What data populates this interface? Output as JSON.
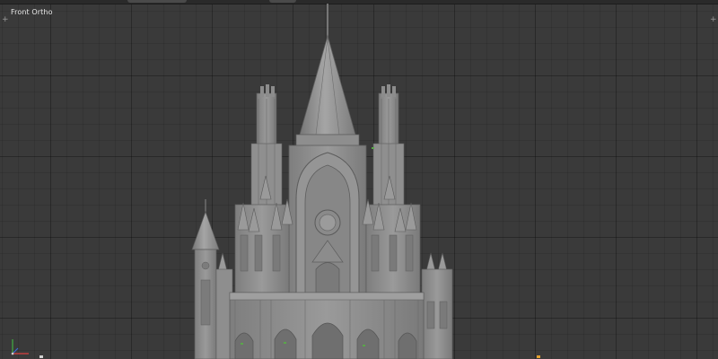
{
  "viewport": {
    "view_label": "Front Ortho",
    "widget_top_left": "+",
    "widget_top_right": "+",
    "background_color": "#3a3a3a",
    "model_color": "#8c8c8c",
    "model_name": "gothic-cathedral-facade"
  },
  "gizmo": {
    "x_axis_color": "#d94040",
    "y_axis_color": "#3a6cd9",
    "z_axis_color": "#40b040"
  }
}
